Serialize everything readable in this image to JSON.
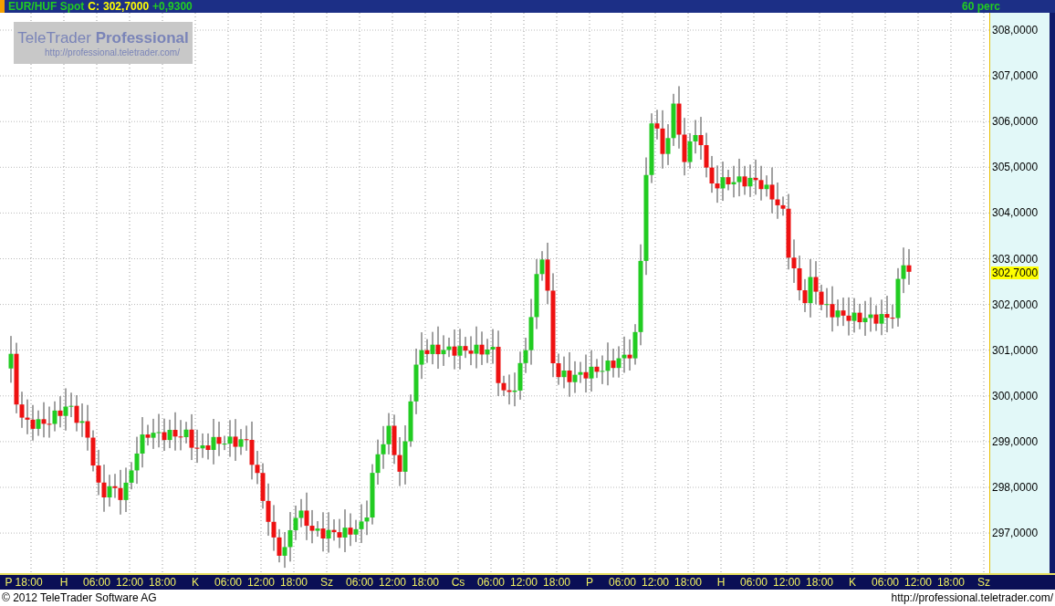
{
  "header": {
    "instrument": "EUR/HUF Spot",
    "close_label": "C:",
    "close_value": "302,7000",
    "change": "+0,9300",
    "period": "60 perc"
  },
  "watermark": {
    "title": "TeleTrader **Professional**",
    "url": "http://professional.teletrader.com/"
  },
  "price_axis": {
    "ticks": [
      "308,0000",
      "307,0000",
      "306,0000",
      "305,0000",
      "304,0000",
      "303,0000",
      "302,0000",
      "301,0000",
      "300,0000",
      "299,0000",
      "298,0000",
      "297,0000"
    ],
    "current": "302,7000"
  },
  "time_axis": {
    "labels": [
      "P 18:00",
      "H",
      "06:00",
      "12:00",
      "18:00",
      "K",
      "06:00",
      "12:00",
      "18:00",
      "Sz",
      "06:00",
      "12:00",
      "18:00",
      "Cs",
      "06:00",
      "12:00",
      "18:00",
      "P",
      "06:00",
      "12:00",
      "18:00",
      "H",
      "06:00",
      "12:00",
      "18:00",
      "K",
      "06:00",
      "12:00",
      "18:00",
      "Sz"
    ]
  },
  "footer": {
    "copyright": "© 2012 TeleTrader Software AG",
    "url": "http://professional.teletrader.com/"
  }
}
